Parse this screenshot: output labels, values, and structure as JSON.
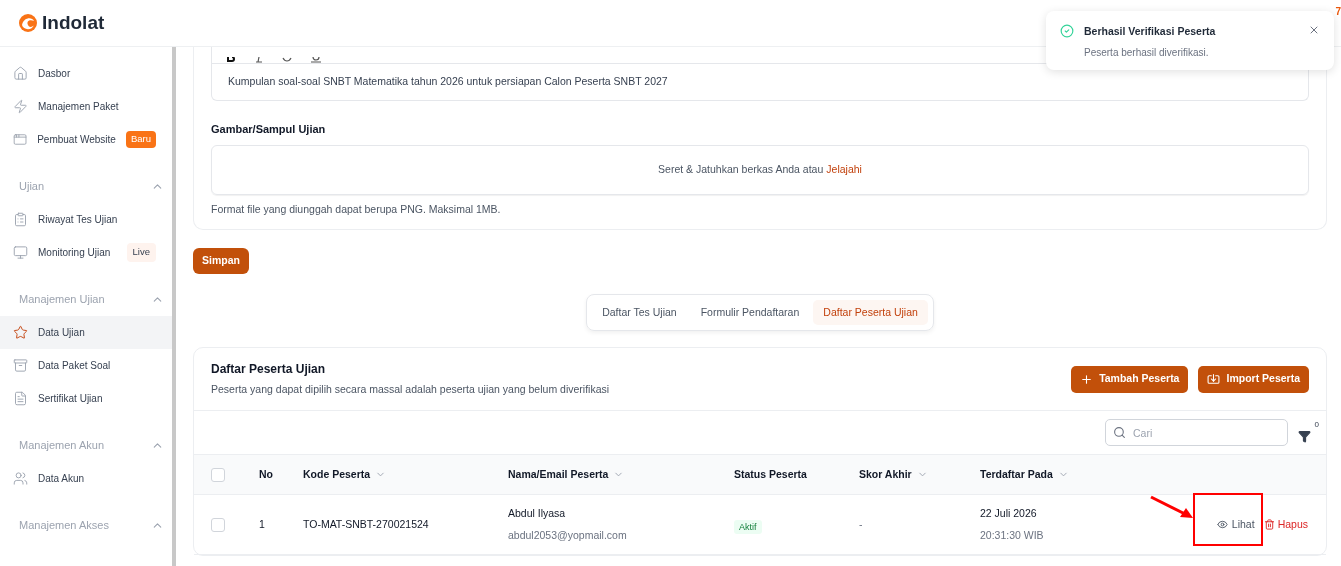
{
  "brand": {
    "name": "Indolat"
  },
  "sidebar": {
    "items": [
      {
        "kind": "item",
        "label": "Dasbor",
        "selected": false
      },
      {
        "kind": "item",
        "label": "Manajemen Paket",
        "selected": false
      },
      {
        "kind": "item",
        "label": "Pembuat Website",
        "selected": false,
        "badge": {
          "text": "Baru",
          "kind": "new"
        }
      },
      {
        "kind": "section",
        "label": "Ujian",
        "expanded": true
      },
      {
        "kind": "item",
        "label": "Riwayat Tes Ujian",
        "selected": false
      },
      {
        "kind": "item",
        "label": "Monitoring Ujian",
        "selected": false,
        "badge": {
          "text": "Live",
          "kind": "live"
        }
      },
      {
        "kind": "section",
        "label": "Manajemen Ujian",
        "expanded": true
      },
      {
        "kind": "item",
        "label": "Data Ujian",
        "selected": true
      },
      {
        "kind": "item",
        "label": "Data Paket Soal",
        "selected": false
      },
      {
        "kind": "item",
        "label": "Sertifikat Ujian",
        "selected": false
      },
      {
        "kind": "section",
        "label": "Manajemen Akun",
        "expanded": true
      },
      {
        "kind": "item",
        "label": "Data Akun",
        "selected": false
      },
      {
        "kind": "section",
        "label": "Manajemen Akses",
        "expanded": true
      }
    ]
  },
  "notification_count": "7",
  "toast": {
    "title": "Berhasil Verifikasi Peserta",
    "message": "Peserta berhasil diverifikasi."
  },
  "form": {
    "description_value": "Kumpulan soal-soal SNBT Matematika tahun 2026 untuk persiapan Calon Peserta SNBT 2027",
    "cover_label": "Gambar/Sampul Ujian",
    "drop_text": "Seret & Jatuhkan berkas Anda atau",
    "browse_link": "Jelajahi",
    "hint": "Format file yang diunggah dapat berupa PNG. Maksimal 1MB.",
    "save_button": "Simpan"
  },
  "tabs": [
    {
      "label": "Daftar Tes Ujian",
      "selected": false
    },
    {
      "label": "Formulir Pendaftaran",
      "selected": false
    },
    {
      "label": "Daftar Peserta Ujian",
      "selected": true
    }
  ],
  "participants": {
    "title": "Daftar Peserta Ujian",
    "subtitle": "Peserta yang dapat dipilih secara massal adalah peserta ujian yang belum diverifikasi",
    "buttons": [
      {
        "label": "Tambah Peserta"
      },
      {
        "label": "Import Peserta"
      }
    ],
    "all_checked": false,
    "search": {
      "placeholder": "Cari"
    },
    "filter_count": "0",
    "columns": [
      {
        "label": "No",
        "sortable": false
      },
      {
        "label": "Kode Peserta",
        "sortable": true
      },
      {
        "label": "Nama/Email Peserta",
        "sortable": true
      },
      {
        "label": "Status Peserta",
        "sortable": false
      },
      {
        "label": "Skor Akhir",
        "sortable": true
      },
      {
        "label": "Terdaftar Pada",
        "sortable": true
      }
    ],
    "rows": [
      {
        "checked": false,
        "no": "1",
        "code": "TO-MAT-SNBT-270021524",
        "name": "Abdul Ilyasa",
        "email": "abdul2053@yopmail.com",
        "status": "Aktif",
        "score": "-",
        "date": "22 Juli 2026",
        "time": "20:31:30 WIB",
        "view": "Lihat",
        "delete": "Hapus",
        "highlighted": true
      }
    ]
  }
}
